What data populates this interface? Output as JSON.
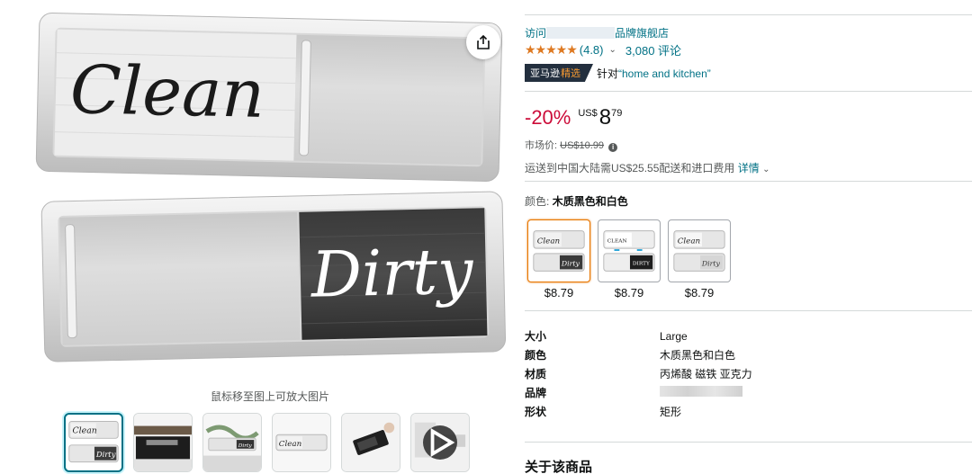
{
  "gallery": {
    "main_image": {
      "top_word": "Clean",
      "bottom_word": "Dirty"
    },
    "share_icon": "share-icon",
    "zoom_hint": "鼠标移至图上可放大图片",
    "thumbnails": [
      {
        "kind": "image",
        "selected": true
      },
      {
        "kind": "image",
        "selected": false
      },
      {
        "kind": "image",
        "selected": false
      },
      {
        "kind": "image",
        "selected": false
      },
      {
        "kind": "image",
        "selected": false
      },
      {
        "kind": "video",
        "selected": false
      }
    ]
  },
  "product": {
    "store_link_prefix": "访问",
    "store_link_suffix": "品牌旗舰店",
    "rating": {
      "stars": "★★★★★",
      "value": "(4.8)",
      "reviews": "3,080 评论",
      "chevron": "⌄"
    },
    "choice": {
      "badge_a": "亚马逊",
      "badge_b": "精选",
      "for_prefix": "针对",
      "keyword": "“home and kitchen”"
    },
    "price": {
      "discount": "-20%",
      "currency": "US$",
      "whole": "8",
      "fraction": "79"
    },
    "list_price": {
      "label": "市场价:",
      "value": "US$10.99"
    },
    "shipping": {
      "text": "运送到中国大陆需US$25.55配送和进口费用",
      "details": "详情",
      "chevron": "⌄"
    },
    "color": {
      "label": "颜色:",
      "selected": "木质黑色和白色"
    },
    "swatches": [
      {
        "price": "$8.79",
        "selected": true
      },
      {
        "price": "$8.79",
        "selected": false
      },
      {
        "price": "$8.79",
        "selected": false
      }
    ],
    "specs": [
      {
        "key": "大小",
        "value": "Large"
      },
      {
        "key": "颜色",
        "value": "木质黑色和白色"
      },
      {
        "key": "材质",
        "value": "丙烯酸 磁铁 亚克力"
      },
      {
        "key": "品牌",
        "value": ""
      },
      {
        "key": "形状",
        "value": "矩形"
      }
    ],
    "about_heading": "关于该商品"
  },
  "colors": {
    "link": "#007185",
    "star": "#DE7921",
    "discount": "#CC0C39",
    "selected_thumb": "#007185",
    "selected_swatch": "#E77600"
  }
}
